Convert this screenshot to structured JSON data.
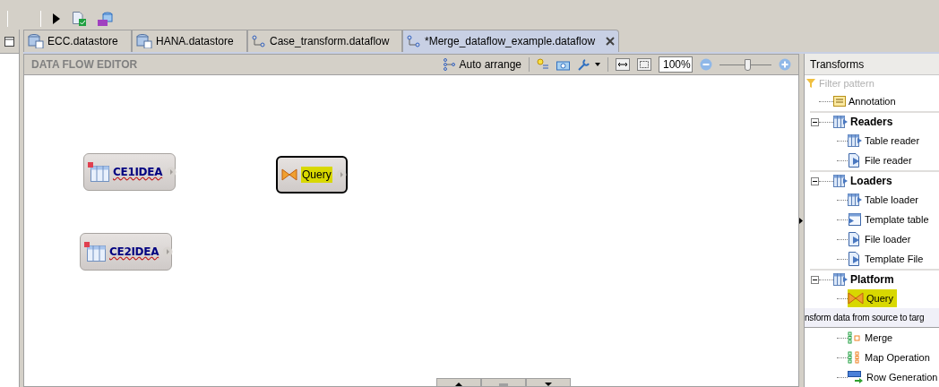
{
  "tabs": [
    {
      "label": "ECC.datastore",
      "kind": "datastore",
      "selected": false
    },
    {
      "label": "HANA.datastore",
      "kind": "datastore",
      "selected": false
    },
    {
      "label": "Case_transform.dataflow",
      "kind": "dataflow",
      "selected": false
    },
    {
      "label": "*Merge_dataflow_example.dataflow",
      "kind": "dataflow",
      "selected": true
    }
  ],
  "editor": {
    "title": "DATA FLOW EDITOR",
    "auto_arrange": "Auto arrange",
    "zoom": "100%",
    "zoom_slider": {
      "level": 0.55
    }
  },
  "nodes": [
    {
      "label": "CE1IDEA",
      "kind": "table",
      "selected": false
    },
    {
      "label": "CE2IDEA",
      "kind": "table",
      "selected": false
    },
    {
      "label": "Query",
      "kind": "query",
      "selected": true
    }
  ],
  "transforms": {
    "title": "Transforms",
    "filter_placeholder": "Filter pattern",
    "items": [
      {
        "label": "Annotation",
        "kind": "annotation"
      },
      {
        "label": "Readers",
        "kind": "group",
        "expanded": true,
        "children": [
          {
            "label": "Table reader",
            "kind": "reader",
            "selected": false
          },
          {
            "label": "File reader",
            "kind": "file",
            "selected": false
          }
        ]
      },
      {
        "label": "Loaders",
        "kind": "group",
        "expanded": true,
        "children": [
          {
            "label": "Table loader",
            "kind": "reader",
            "selected": false
          },
          {
            "label": "Template table",
            "kind": "template",
            "selected": false
          },
          {
            "label": "File loader",
            "kind": "file",
            "selected": false
          },
          {
            "label": "Template File",
            "kind": "file",
            "selected": false
          }
        ]
      },
      {
        "label": "Platform",
        "kind": "group",
        "expanded": true,
        "children": [
          {
            "label": "Query",
            "kind": "query",
            "selected": true,
            "tooltip": "nsform data from source to targ"
          },
          {
            "label": "Merge",
            "kind": "merge",
            "selected": false
          },
          {
            "label": "Map Operation",
            "kind": "map",
            "selected": false
          },
          {
            "label": "Row Generation",
            "kind": "rowgen",
            "selected": false
          }
        ]
      }
    ]
  }
}
